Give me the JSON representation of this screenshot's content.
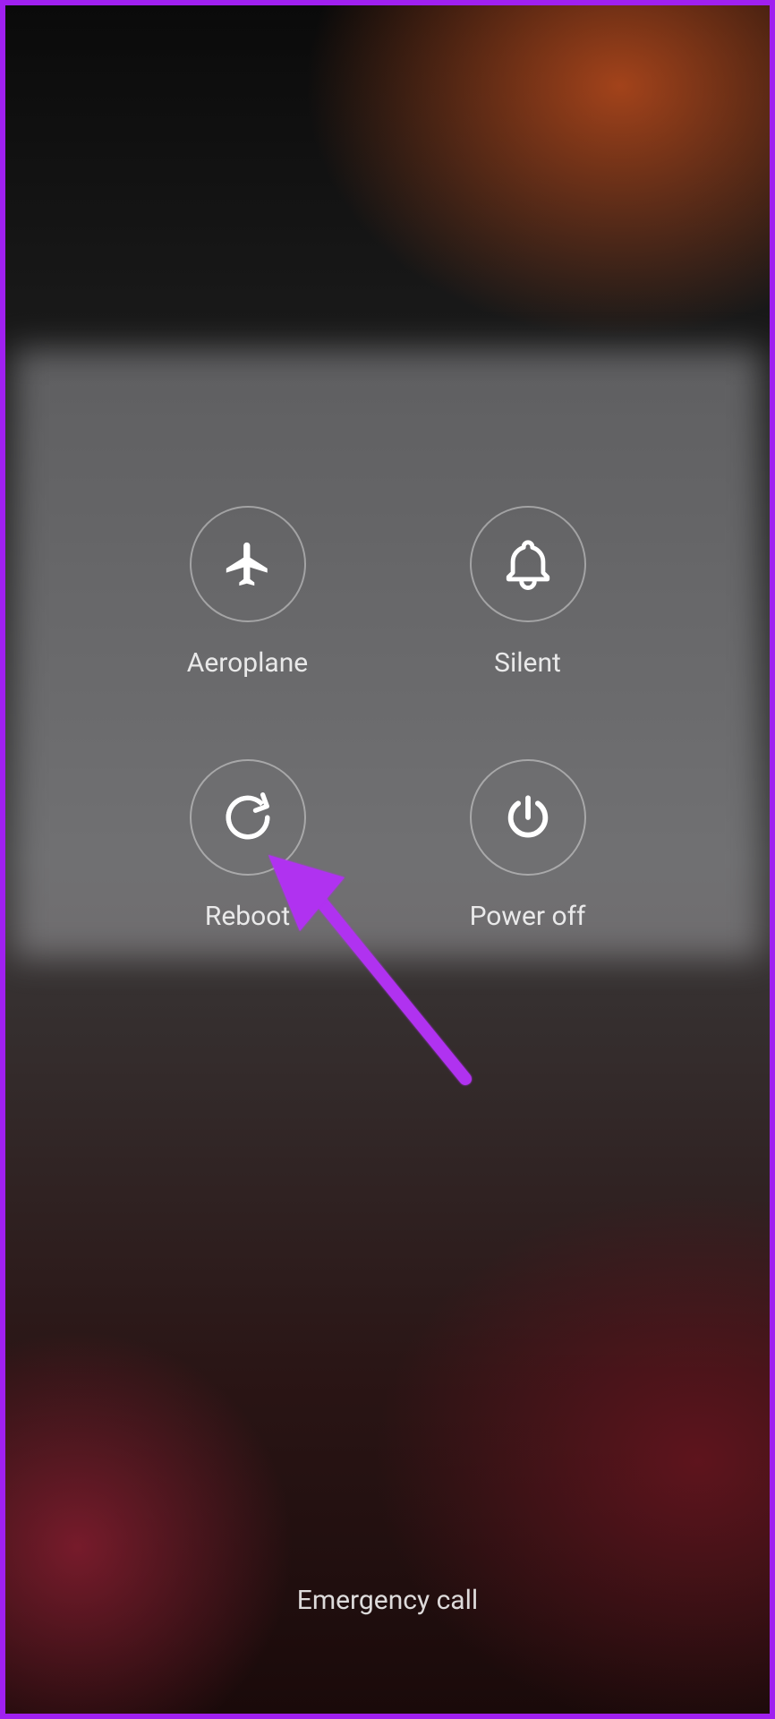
{
  "menu": {
    "aeroplane": {
      "label": "Aeroplane",
      "icon": "airplane-icon"
    },
    "silent": {
      "label": "Silent",
      "icon": "bell-icon"
    },
    "reboot": {
      "label": "Reboot",
      "icon": "restart-icon"
    },
    "poweroff": {
      "label": "Power off",
      "icon": "power-icon"
    }
  },
  "footer": {
    "emergency_label": "Emergency call"
  },
  "annotation": {
    "arrow_points_to": "reboot",
    "arrow_color": "#b030f0"
  }
}
